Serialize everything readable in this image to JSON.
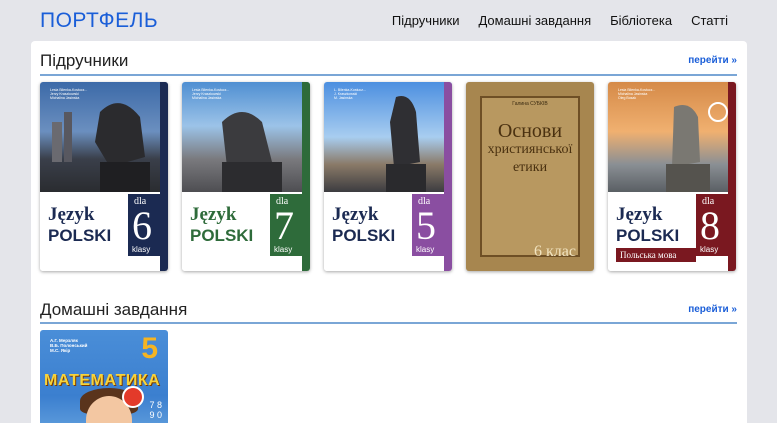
{
  "header": {
    "logo": "ПОРТФЕЛЬ",
    "nav": [
      "Підручники",
      "Домашні завдання",
      "Бібліотека",
      "Статті"
    ]
  },
  "sections": {
    "textbooks": {
      "title": "Підручники",
      "link": "перейти »"
    },
    "homework": {
      "title": "Домашні завдання",
      "link": "перейти »"
    }
  },
  "books": [
    {
      "authors": "Lesia Bilenka-Kostucz...\nJerzy Kraszkowski\nMichalina Jasinska",
      "line1": "Język",
      "line2": "POLSKI",
      "dla": "dla",
      "grade": "6",
      "klasy": "klasy"
    },
    {
      "authors": "Lesia Bilenka-Kostucz...\nJerzy Kraszkowski\nMichalina Jasinska",
      "line1": "Język",
      "line2": "POLSKI",
      "dla": "dla",
      "grade": "7",
      "klasy": "klasy"
    },
    {
      "authors": "L. Bilenka-Kostucz...\nJ. Kraszkowski\nM. Jasinska",
      "line1": "Język",
      "line2": "POLSKI",
      "dla": "dla",
      "grade": "5",
      "klasy": "klasy"
    },
    {
      "author": "Галина СУБКІВ",
      "t1": "Основи",
      "t2": "християнської",
      "t3": "етики",
      "grade": "6 клас"
    },
    {
      "authors": "Lesia Bilenka-Kostucz...\nMichalina Jasinska\nOleg Bosak",
      "line1": "Język",
      "line2": "POLSKI",
      "dla": "dla",
      "grade": "8",
      "klasy": "klasy",
      "sub": "Польська мова"
    }
  ],
  "homework_book": {
    "authors": "А.Г. Мерзляк\nВ.Б. Полонський\nМ.С. Якір",
    "grade": "5",
    "title": "МАТЕМАТИКА",
    "digits": "7 8\n9 0"
  },
  "colors": {
    "accent": "#1a5ed8",
    "rule": "#7aa6d6",
    "book6_band": "#1b2a52",
    "book7_band": "#2e6b3a",
    "book5_band": "#8a4ea1",
    "book8_band": "#7a1820"
  }
}
